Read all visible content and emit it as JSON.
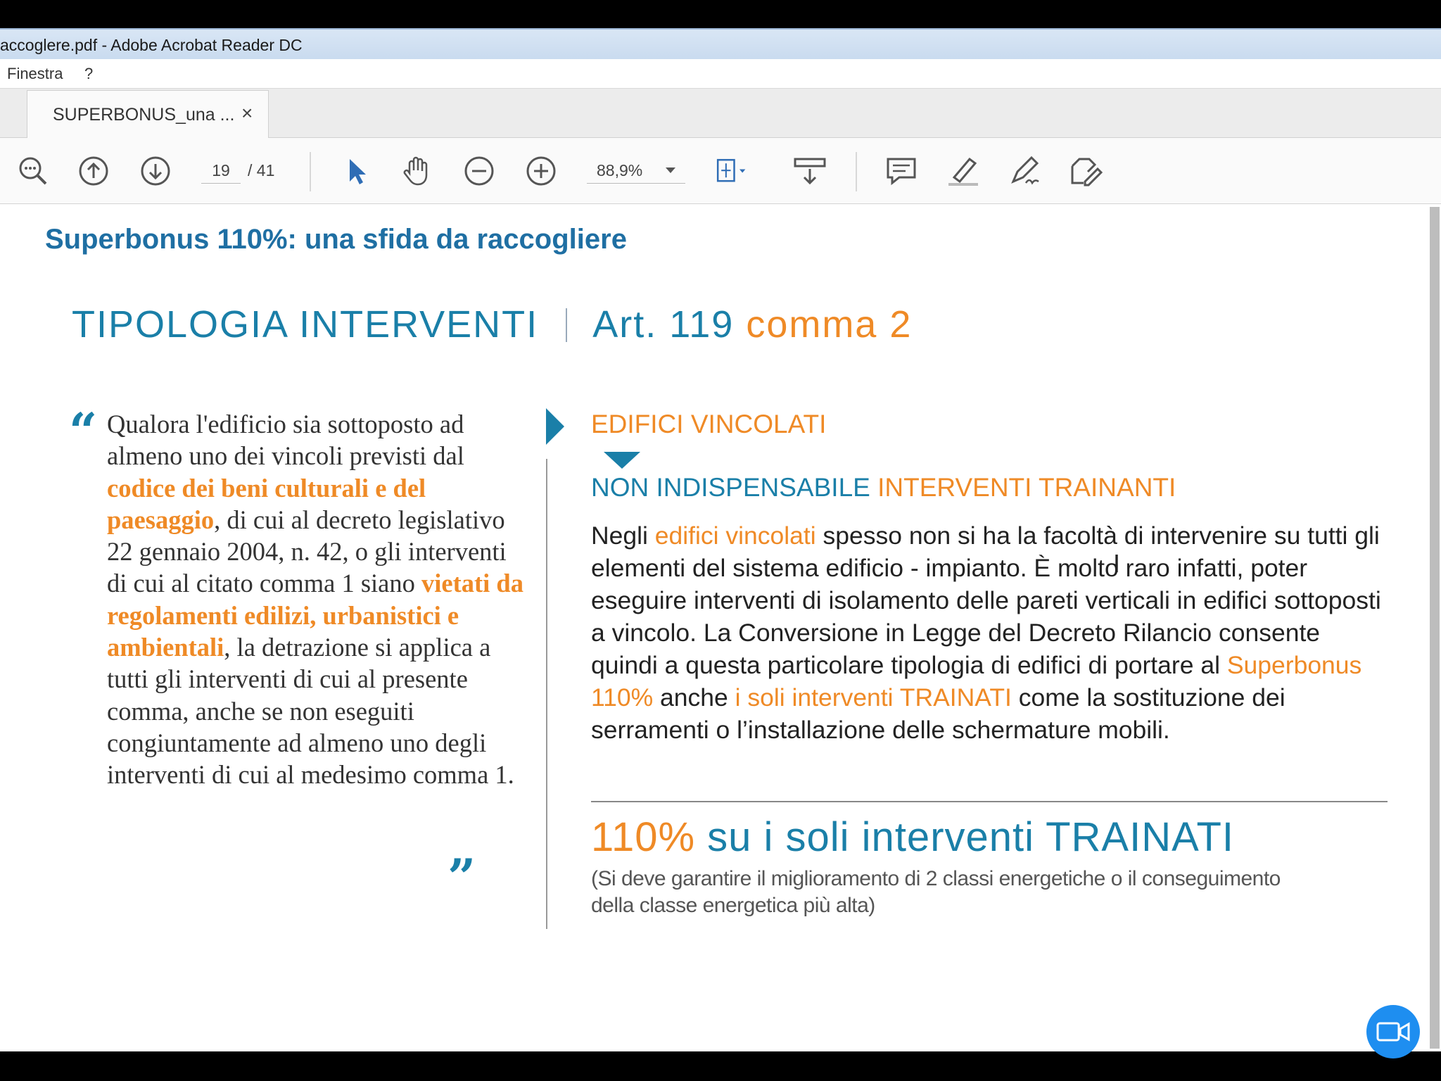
{
  "window": {
    "title": "accoglere.pdf - Adobe Acrobat Reader DC"
  },
  "menu": {
    "items": [
      "Finestra",
      "?"
    ]
  },
  "tab": {
    "label": "SUPERBONUS_una ...",
    "close": "×"
  },
  "toolbar": {
    "current_page": "19",
    "total_pages": "/ 41",
    "zoom": "88,9%",
    "icons": [
      "search-zoom-icon",
      "page-up-icon",
      "page-down-icon",
      "select-arrow-icon",
      "hand-tool-icon",
      "zoom-out-icon",
      "zoom-in-icon",
      "fit-page-icon",
      "read-mode-icon",
      "comment-icon",
      "highlight-icon",
      "sign-icon",
      "edit-tools-icon"
    ]
  },
  "document": {
    "title": "Superbonus 110%: una sfida da raccogliere",
    "heading": {
      "part1": "TIPOLOGIA INTERVENTI",
      "part2": "Art. 119",
      "part3": "comma 2"
    },
    "quote": {
      "open": "“",
      "close": "”",
      "t1": "Qualora l'edificio sia sottoposto ad almeno uno dei vincoli previsti dal ",
      "b1": "codice dei beni culturali e del paesaggio",
      "t2": ", di cui al decreto legislativo 22 gennaio 2004, n. 42, o gli interventi di cui al citato comma 1 siano ",
      "b2": "vietati da regolamenti edilizi, urbanistici e ambientali",
      "t3": ", la detrazione si applica a tutti gli interventi di cui al presente comma, anche se non eseguiti congiuntamente ad almeno uno degli interventi di cui al medesimo comma 1."
    },
    "edifici_vincolati": "EDIFICI VINCOLATI",
    "non_indispensabile": {
      "blue": "NON INDISPENSABILE",
      "orange": "INTERVENTI TRAINANTI"
    },
    "paragraph": {
      "p1": "Negli ",
      "o1": "edifici vincolati",
      "p2": " spesso non si ha la facoltà di intervenire su tutti gli elementi del sistema edificio - impianto. È molto raro infatti, poter eseguire interventi di isolamento delle pareti verticali in edifici sottoposti a vincolo. La Conversione in Legge del Decreto Rilancio consente quindi a questa particolare tipologia di edifici di portare al ",
      "o2": "Superbonus 110%",
      "p3": " anche ",
      "o3": "i soli interventi TRAINATI",
      "p4": " come la sostituzione dei serramenti o l’installazione delle schermature mobili."
    },
    "big": {
      "orange": "110%",
      "blue": " su i soli interventi TRAINATI"
    },
    "note": "(Si deve garantire il miglioramento di 2 classi energetiche o il conseguimento della classe energetica più alta)"
  },
  "colors": {
    "accent_blue": "#1a7fa8",
    "accent_orange": "#ef8a26",
    "acrobat_blue": "#2f6db5"
  }
}
